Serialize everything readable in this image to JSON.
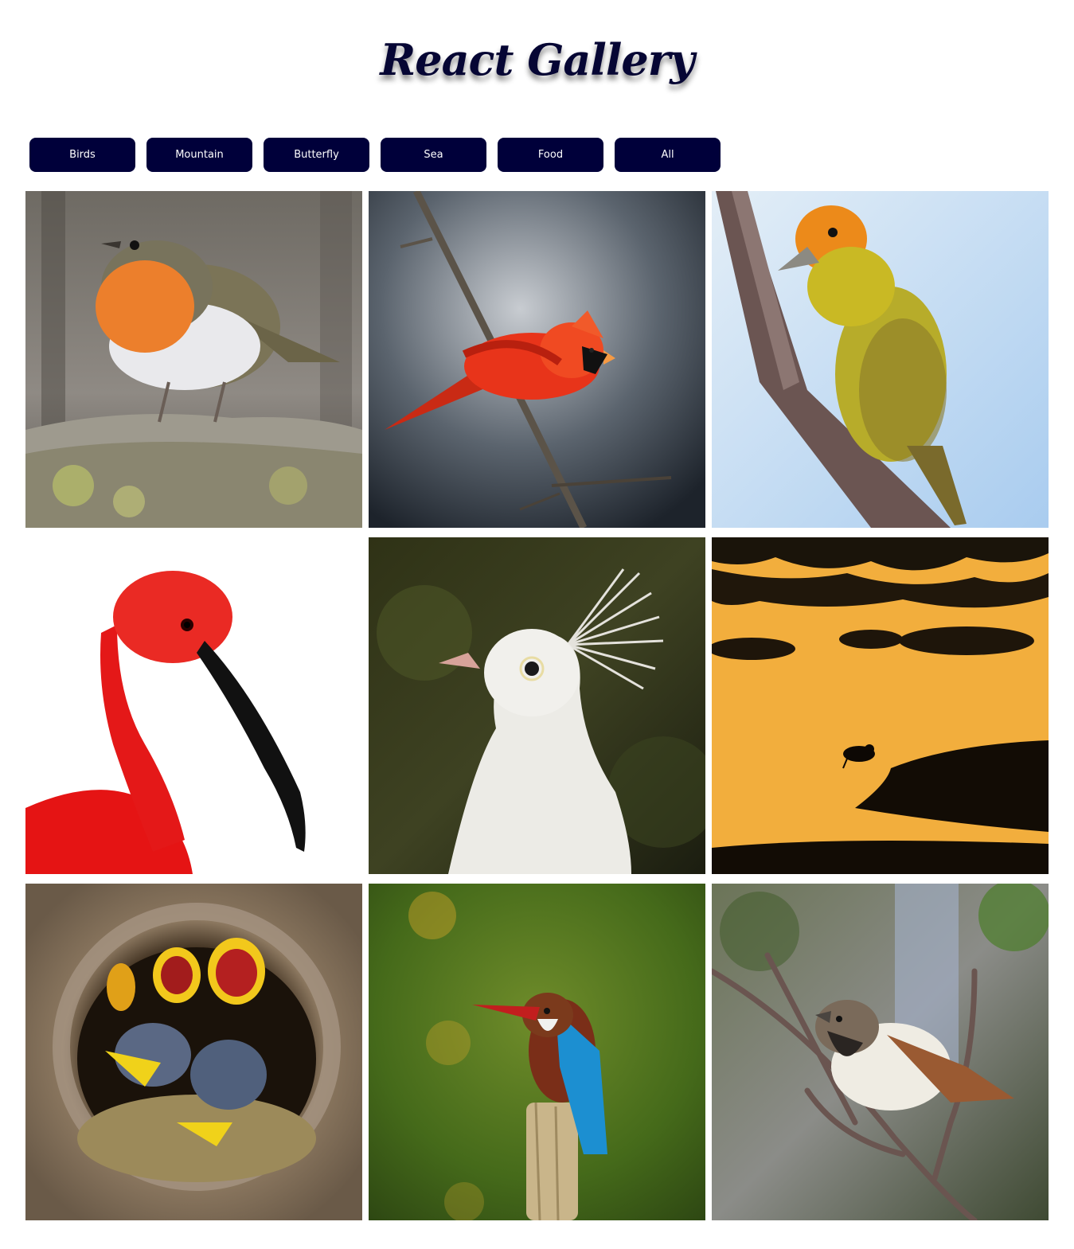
{
  "header": {
    "title": "React Gallery"
  },
  "filters": [
    {
      "label": "Birds"
    },
    {
      "label": "Mountain"
    },
    {
      "label": "Butterfly"
    },
    {
      "label": "Sea"
    },
    {
      "label": "Food"
    },
    {
      "label": "All"
    }
  ],
  "colors": {
    "accent": "#00003a",
    "title": "#060634",
    "button_text": "#ffffff"
  },
  "gallery": {
    "category": "Birds",
    "images": [
      {
        "subject": "robin"
      },
      {
        "subject": "northern-cardinal"
      },
      {
        "subject": "yellow-songbird"
      },
      {
        "subject": "scarlet-ibis"
      },
      {
        "subject": "white-peacock"
      },
      {
        "subject": "silhouette-wader-at-sunset"
      },
      {
        "subject": "nestlings-in-tree-hollow"
      },
      {
        "subject": "kingfisher"
      },
      {
        "subject": "house-sparrow"
      }
    ]
  }
}
